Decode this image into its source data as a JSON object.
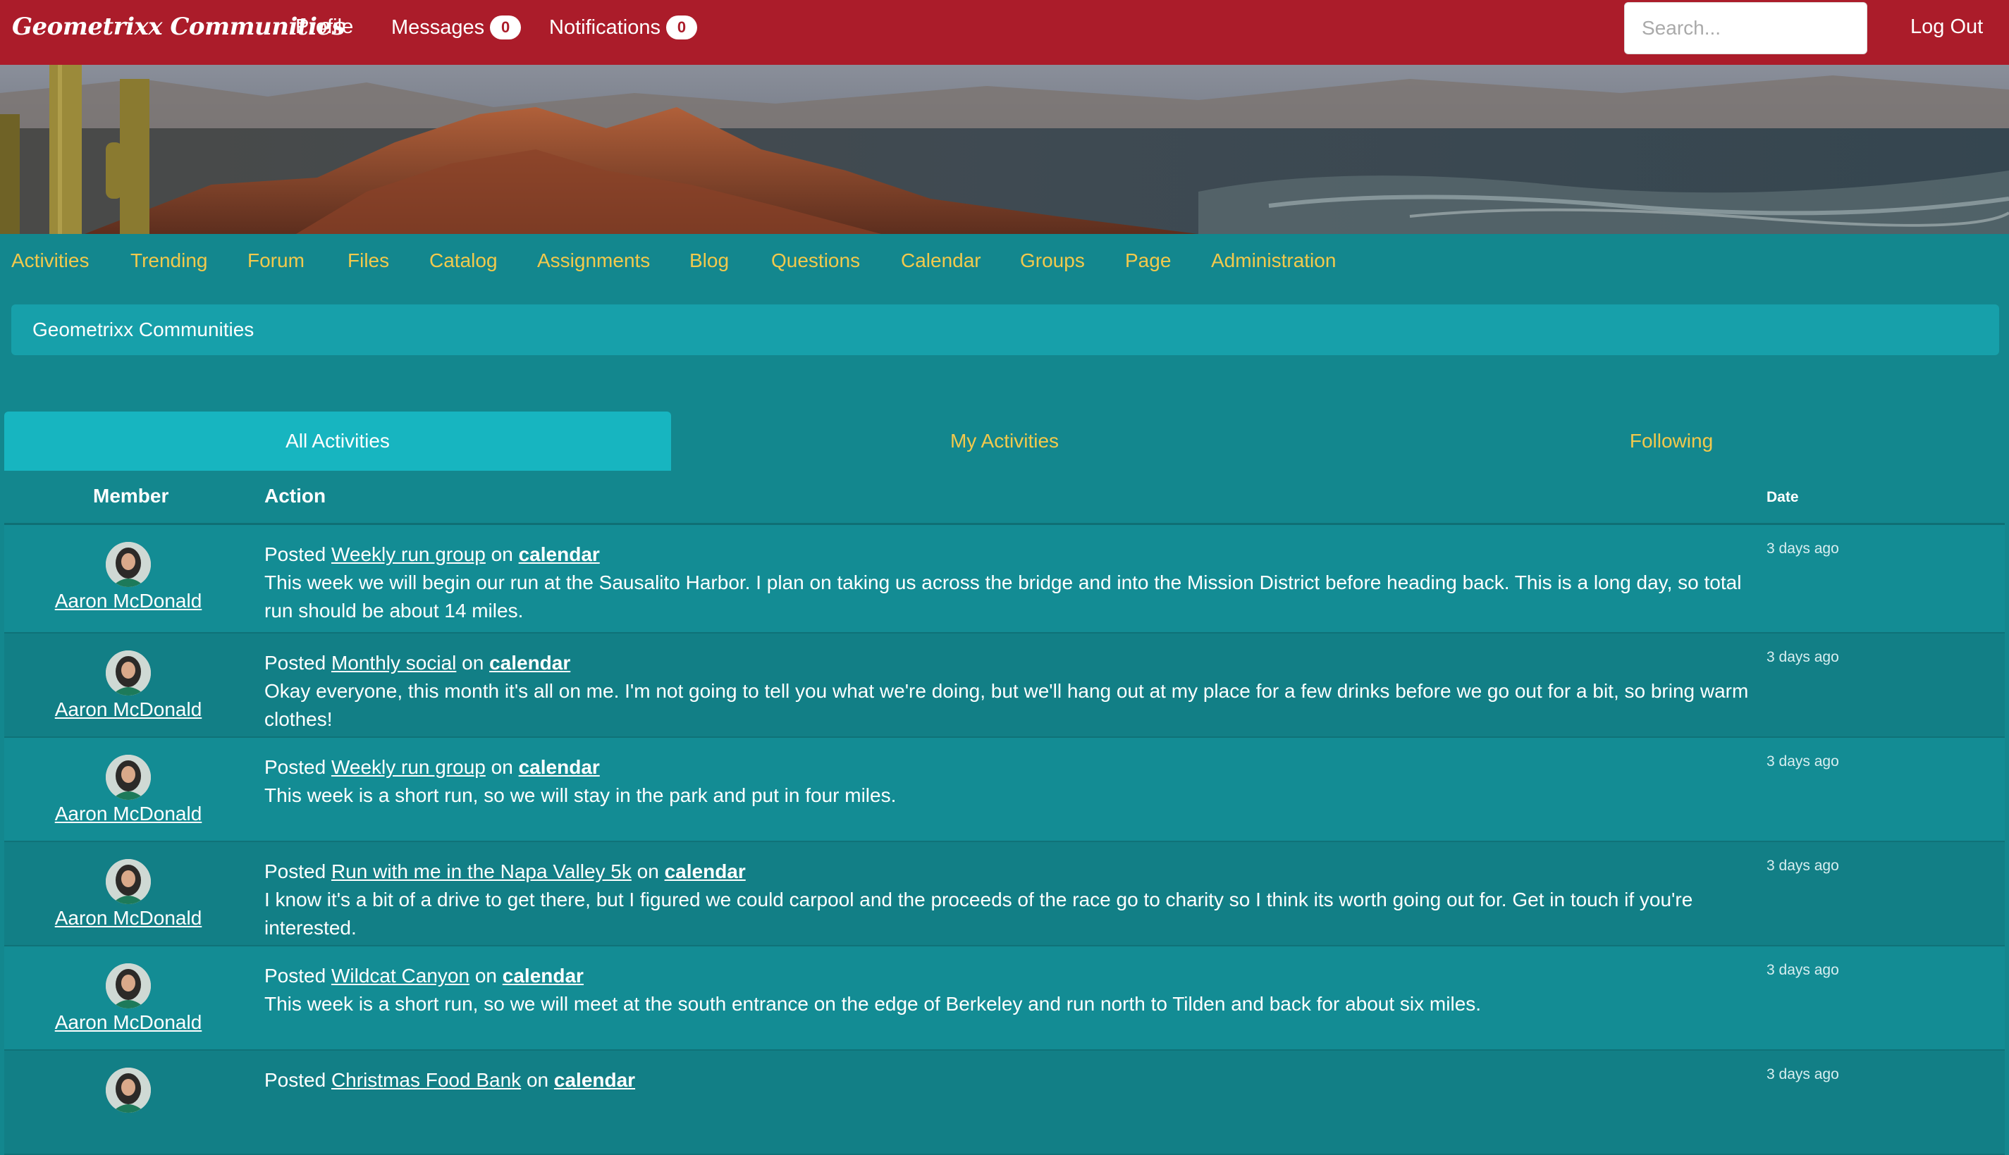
{
  "header": {
    "brand": "Geometrixx Communities",
    "nav": [
      {
        "label": "Profile"
      },
      {
        "label": "Messages",
        "count": "0"
      },
      {
        "label": "Notifications",
        "count": "0"
      }
    ],
    "search_placeholder": "Search...",
    "logout_label": "Log Out",
    "brand_color": "#ab1c2a"
  },
  "section_nav": {
    "items": [
      "Activities",
      "Trending",
      "Forum",
      "Files",
      "Catalog",
      "Assignments",
      "Blog",
      "Questions",
      "Calendar",
      "Groups",
      "Page",
      "Administration"
    ]
  },
  "breadcrumb": "Geometrixx Communities",
  "tabs": [
    {
      "label": "All Activities",
      "active": true
    },
    {
      "label": "My Activities",
      "active": false
    },
    {
      "label": "Following",
      "active": false
    }
  ],
  "table": {
    "columns": {
      "member": "Member",
      "action": "Action",
      "date": "Date"
    },
    "rows": [
      {
        "member": "Aaron McDonald",
        "verb": "Posted",
        "title": "Weekly run group",
        "on": "on",
        "target": "calendar",
        "text": "This week we will begin our run at the Sausalito Harbor. I plan on taking us across the bridge and into the Mission District before heading back. This is a long day, so total run should be about 14 miles.",
        "date": "3 days ago"
      },
      {
        "member": "Aaron McDonald",
        "verb": "Posted",
        "title": "Monthly social",
        "on": "on",
        "target": "calendar",
        "text": "Okay everyone, this month it's all on me. I'm not going to tell you what we're doing, but we'll hang out at my place for a few drinks before we go out for a bit, so bring warm clothes!",
        "date": "3 days ago"
      },
      {
        "member": "Aaron McDonald",
        "verb": "Posted",
        "title": "Weekly run group",
        "on": "on",
        "target": "calendar",
        "text": "This week is a short run, so we will stay in the park and put in four miles.",
        "date": "3 days ago"
      },
      {
        "member": "Aaron McDonald",
        "verb": "Posted",
        "title": "Run with me in the Napa Valley 5k",
        "on": "on",
        "target": "calendar",
        "text": "I know it's a bit of a drive to get there, but I figured we could carpool and the proceeds of the race go to charity so I think its worth going out for. Get in touch if you're interested.",
        "date": "3 days ago"
      },
      {
        "member": "Aaron McDonald",
        "verb": "Posted",
        "title": "Wildcat Canyon",
        "on": "on",
        "target": "calendar",
        "text": "This week is a short run, so we will meet at the south entrance on the edge of Berkeley and run north to Tilden and back for about six miles.",
        "date": "3 days ago"
      },
      {
        "member": "",
        "verb": "Posted",
        "title": "Christmas Food Bank",
        "on": "on",
        "target": "calendar",
        "text": "",
        "date": "3 days ago"
      }
    ]
  }
}
